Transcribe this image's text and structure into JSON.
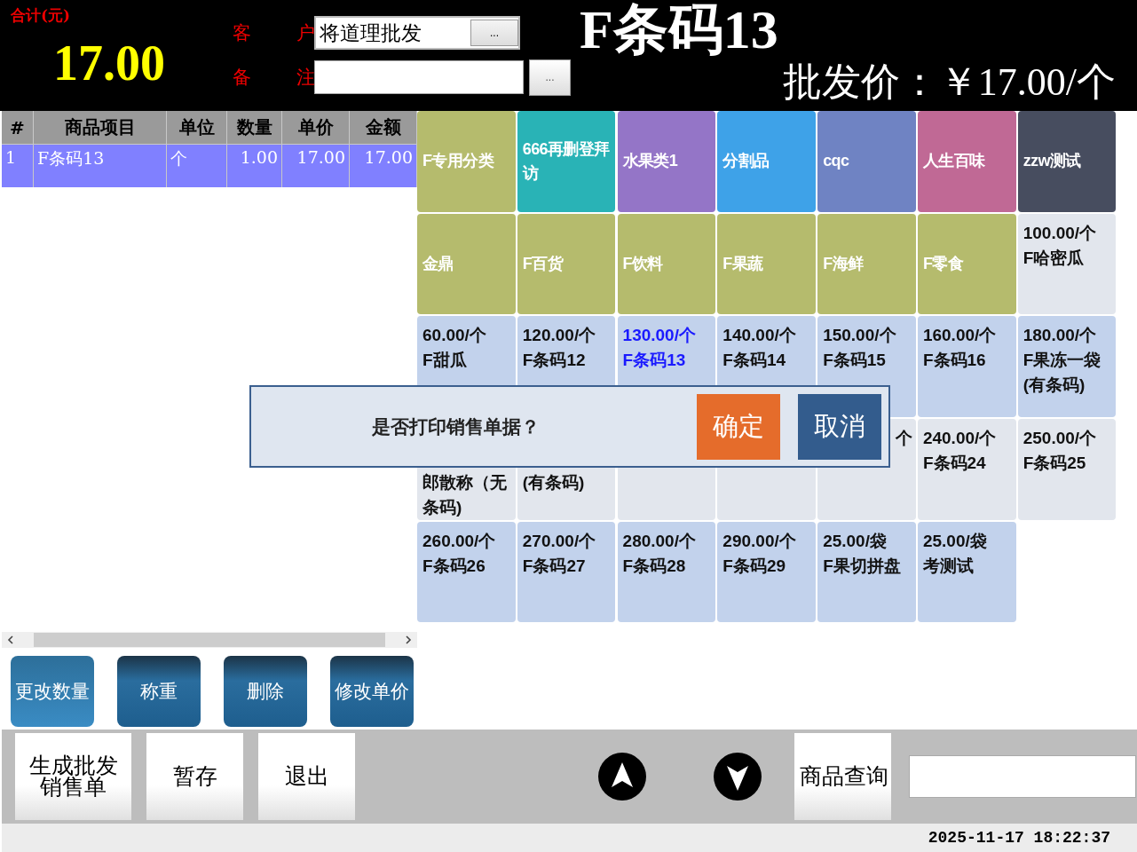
{
  "summary": {
    "label": "合计(元)",
    "total": "17.00"
  },
  "customer": {
    "label": "客 户",
    "value": "将道理批发",
    "button": "..."
  },
  "remark": {
    "label": "备 注",
    "button": "..."
  },
  "product_title": "F条码13",
  "price_line": "批发价：￥17.00/个",
  "table": {
    "columns": [
      "#",
      "商品项目",
      "单位",
      "数量",
      "单价",
      "金额"
    ],
    "rows": [
      {
        "cells": [
          "1",
          "F条码13",
          "个",
          "1.00",
          "17.00",
          "17.00"
        ],
        "selected": true
      }
    ]
  },
  "actions": [
    "更改数量",
    "称重",
    "删除",
    "修改单价"
  ],
  "tiles": [
    [
      {
        "kind": "category",
        "label": "F专用分类",
        "color": "#b5bb6d"
      },
      {
        "kind": "category",
        "label": "666再删登拜访",
        "color": "#29b3b6"
      },
      {
        "kind": "category",
        "label": "水果类1",
        "color": "#9475c7"
      },
      {
        "kind": "category",
        "label": "分割品",
        "color": "#3ea2e8"
      },
      {
        "kind": "category",
        "label": "cqc",
        "color": "#6f83c3"
      },
      {
        "kind": "category",
        "label": "人生百味",
        "color": "#c06995"
      },
      {
        "kind": "category",
        "label": "zzw测试",
        "color": "#474d5f"
      }
    ],
    [
      {
        "kind": "category",
        "label": "金鼎",
        "color": "#b5bb6d"
      },
      {
        "kind": "category",
        "label": "F百货",
        "color": "#b5bb6d"
      },
      {
        "kind": "category",
        "label": "F饮料",
        "color": "#b5bb6d"
      },
      {
        "kind": "category",
        "label": "F果蔬",
        "color": "#b5bb6d"
      },
      {
        "kind": "category",
        "label": "F海鲜",
        "color": "#b5bb6d"
      },
      {
        "kind": "category",
        "label": "F零食",
        "color": "#b5bb6d"
      },
      {
        "kind": "product",
        "price": "100.00/个",
        "name": "F哈密瓜",
        "color": "#e2e6ed",
        "selected": false
      }
    ],
    [
      {
        "kind": "product",
        "price": "60.00/个",
        "name": "F甜瓜",
        "color": "#c2d2ec",
        "selected": false
      },
      {
        "kind": "product",
        "price": "120.00/个",
        "name": "F条码12",
        "color": "#c2d2ec",
        "selected": false
      },
      {
        "kind": "product",
        "price": "130.00/个",
        "name": "F条码13",
        "color": "#c2d2ec",
        "selected": true
      },
      {
        "kind": "product",
        "price": "140.00/个",
        "name": "F条码14",
        "color": "#c2d2ec",
        "selected": false
      },
      {
        "kind": "product",
        "price": "150.00/个",
        "name": "F条码15",
        "color": "#c2d2ec",
        "selected": false
      },
      {
        "kind": "product",
        "price": "160.00/个",
        "name": "F条码16",
        "color": "#c2d2ec",
        "selected": false
      },
      {
        "kind": "product",
        "price": "180.00/个",
        "name": "F果冻一袋(有条码)",
        "color": "#c2d2ec",
        "selected": false
      }
    ],
    [
      {
        "kind": "cut-bottom",
        "text": "郎散称（无条码)",
        "color": "#e2e6ed"
      },
      {
        "kind": "cut-bottom",
        "text": "(有条码)",
        "color": "#e2e6ed"
      },
      {
        "kind": "blank",
        "color": "#e2e6ed"
      },
      {
        "kind": "blank",
        "color": "#e2e6ed"
      },
      {
        "kind": "cut-top",
        "text": "个",
        "color": "#e2e6ed"
      },
      {
        "kind": "product",
        "price": "240.00/个",
        "name": "F条码24",
        "color": "#e2e6ed",
        "selected": false
      },
      {
        "kind": "product",
        "price": "250.00/个",
        "name": "F条码25",
        "color": "#e2e6ed",
        "selected": false
      }
    ],
    [
      {
        "kind": "product",
        "price": "260.00/个",
        "name": "F条码26",
        "color": "#c2d2ec",
        "selected": false
      },
      {
        "kind": "product",
        "price": "270.00/个",
        "name": "F条码27",
        "color": "#c2d2ec",
        "selected": false
      },
      {
        "kind": "product",
        "price": "280.00/个",
        "name": "F条码28",
        "color": "#c2d2ec",
        "selected": false
      },
      {
        "kind": "product",
        "price": "290.00/个",
        "name": "F条码29",
        "color": "#c2d2ec",
        "selected": false
      },
      {
        "kind": "product",
        "price": "25.00/袋",
        "name": "F果切拼盘",
        "color": "#c2d2ec",
        "selected": false
      },
      {
        "kind": "product",
        "price": "25.00/袋",
        "name": "考测试",
        "color": "#c2d2ec",
        "selected": false
      }
    ]
  ],
  "dialog": {
    "message": "是否打印销售单据？",
    "confirm": "确定",
    "cancel": "取消"
  },
  "bottom_buttons": [
    "生成批发销售单",
    "暂存",
    "退出"
  ],
  "search_button": "商品查询",
  "status": {
    "datetime": "2025-11-17 18:22:37"
  }
}
